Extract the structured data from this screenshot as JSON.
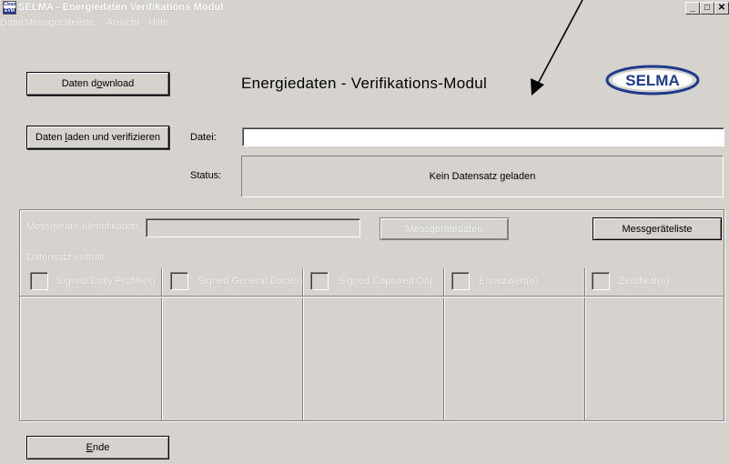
{
  "window": {
    "title": "SELMA - Energiedaten Verifikations Modul",
    "icon_top": "Clean",
    "icon_bottom": "EVM",
    "controls": [
      "minimize-icon",
      "maximize-icon",
      "close-icon"
    ]
  },
  "menu": [
    "Datei",
    "Messgeräteliste",
    "Ansicht",
    "Hilfe"
  ],
  "buttons": {
    "download_pre": "Daten d",
    "download_u": "o",
    "download_post": "wnload",
    "laden_pre": "Daten ",
    "laden_u": "l",
    "laden_post": "aden und verifizieren",
    "messgeraetedaten": "Messgerätedaten",
    "messgeraeteliste": "Messgeräteliste",
    "ende_u": "E",
    "ende_post": "nde"
  },
  "heading": "Energiedaten - Verifikations-Modul",
  "logo": {
    "text": "SELMA",
    "color": "#1d3a8c"
  },
  "datei": {
    "label": "Datei:",
    "value": ""
  },
  "status": {
    "label": "Status:",
    "value": "Kein Datensatz geladen"
  },
  "identification": {
    "label": "Messgeräte-Identifikation:",
    "value": ""
  },
  "datensatz_label": "Datensatz enthält:",
  "columns": [
    {
      "label": "Signed Daily Profile(s)"
    },
    {
      "label": "Signed General Data(s)"
    },
    {
      "label": "Signed Captured Obj."
    },
    {
      "label": "Ersatzwert(e)"
    },
    {
      "label": "Zertifikat(e)"
    }
  ],
  "colors": {
    "face": "#d6d3ce",
    "shadow": "#808080",
    "highlight": "#ffffff"
  }
}
